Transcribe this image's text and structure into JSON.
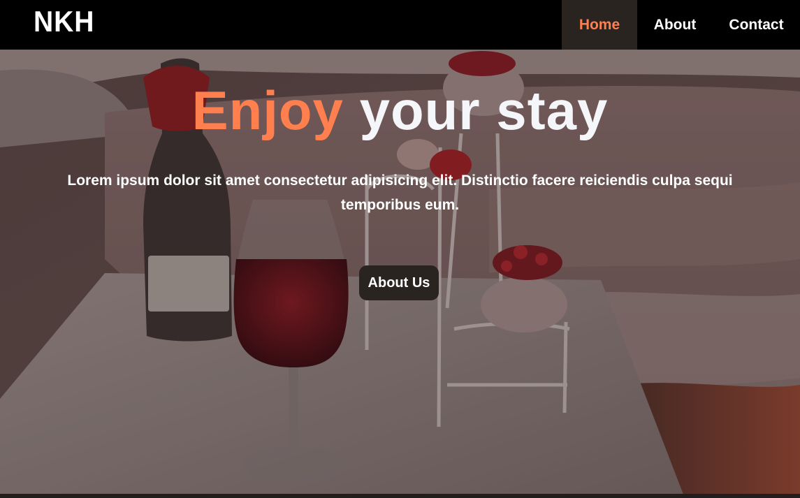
{
  "brand": {
    "logo": "NKH"
  },
  "nav": {
    "items": [
      {
        "label": "Home",
        "active": true
      },
      {
        "label": "About",
        "active": false
      },
      {
        "label": "Contact",
        "active": false
      }
    ]
  },
  "hero": {
    "title_accent": "Enjoy",
    "title_rest": " your stay",
    "text": "Lorem ipsum dolor sit amet consectetur adipisicing elit. Distinctio facere reiciendis culpa sequi temporibus eum.",
    "button_label": "About Us"
  },
  "colors": {
    "accent": "#ff7f4f",
    "nav_bg": "#000000",
    "button_bg": "#2a2421"
  }
}
